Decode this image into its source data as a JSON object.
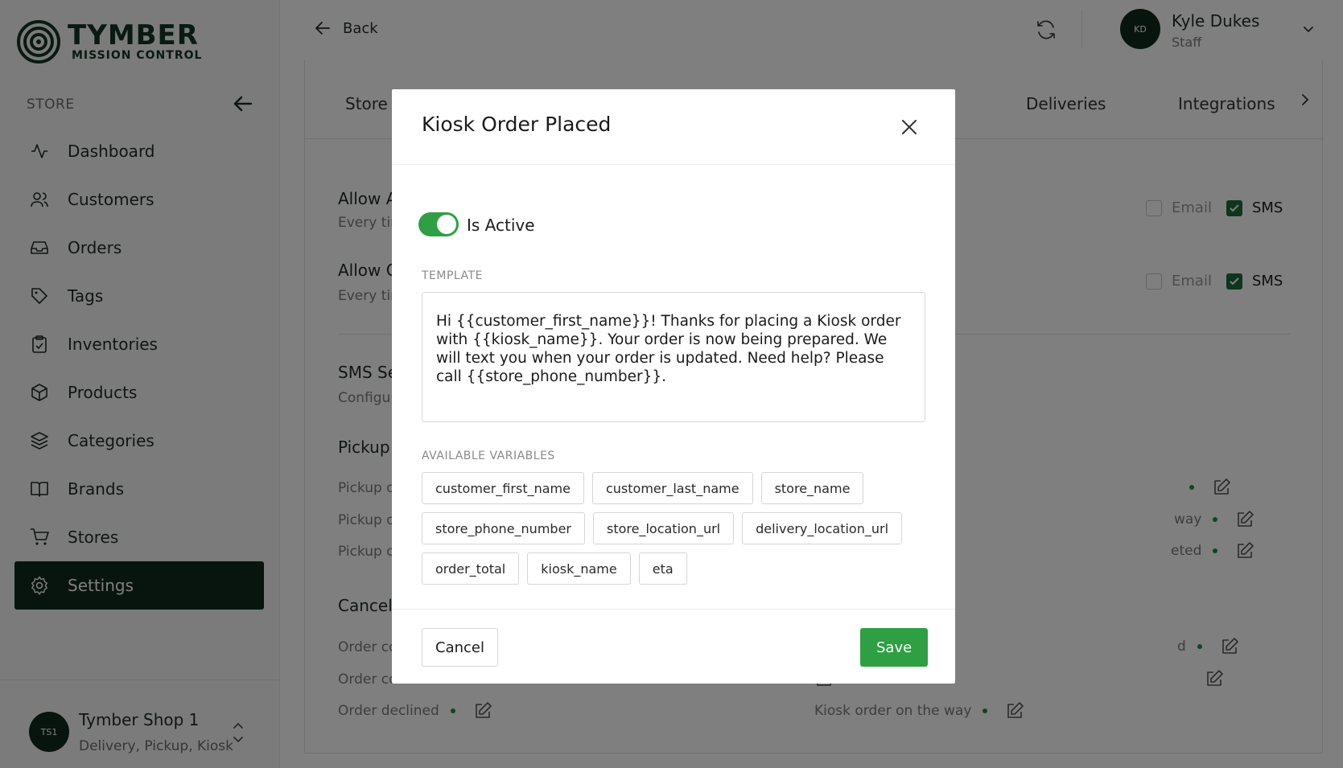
{
  "brand": {
    "title": "TYMBER",
    "subtitle": "MISSION CONTROL"
  },
  "sidebar": {
    "section_label": "STORE",
    "items": [
      {
        "label": "Dashboard",
        "icon": "activity-icon"
      },
      {
        "label": "Customers",
        "icon": "users-icon"
      },
      {
        "label": "Orders",
        "icon": "inbox-icon"
      },
      {
        "label": "Tags",
        "icon": "tag-icon"
      },
      {
        "label": "Inventories",
        "icon": "clipboard-icon"
      },
      {
        "label": "Products",
        "icon": "box-icon"
      },
      {
        "label": "Categories",
        "icon": "layers-icon"
      },
      {
        "label": "Brands",
        "icon": "book-icon"
      },
      {
        "label": "Stores",
        "icon": "cart-icon"
      },
      {
        "label": "Settings",
        "icon": "gear-icon",
        "active": true
      }
    ],
    "store": {
      "initials": "TS1",
      "name": "Tymber Shop 1",
      "types": "Delivery, Pickup, Kiosk"
    }
  },
  "topbar": {
    "back_label": "Back",
    "user": {
      "initials": "KD",
      "name": "Kyle Dukes",
      "role": "Staff"
    }
  },
  "tabs": {
    "first_partial": "Store C",
    "deliveries": "Deliveries",
    "integrations": "Integrations"
  },
  "background": {
    "row1": {
      "title": "Allow A",
      "desc": "Every tin"
    },
    "row2": {
      "title": "Allow C",
      "desc": "Every tin"
    },
    "email_label": "Email",
    "sms_label": "SMS",
    "sms_section": {
      "title": "SMS Se",
      "desc": "Configur"
    },
    "pickup_title": "Pickup",
    "pickup_rows": [
      "Pickup o",
      "Pickup o",
      "Pickup o"
    ],
    "pickup_right": [
      "",
      "way",
      "eted"
    ],
    "cancel_title": "Cancell",
    "cancel_rows": [
      "Order co",
      "Order co",
      "Order declined"
    ],
    "cancel_right": [
      "d",
      "",
      "Kiosk order on the way"
    ]
  },
  "modal": {
    "title": "Kiosk Order Placed",
    "toggle_label": "Is Active",
    "is_active": true,
    "template_label": "TEMPLATE",
    "template_text": "Hi {{customer_first_name}}! Thanks for placing a Kiosk order with {{kiosk_name}}. Your order is now being prepared. We will text you when your order is updated. Need help? Please call {{store_phone_number}}.",
    "variables_label": "AVAILABLE VARIABLES",
    "variables": [
      [
        "customer_first_name",
        "customer_last_name",
        "store_name"
      ],
      [
        "store_phone_number",
        "store_location_url",
        "delivery_location_url"
      ],
      [
        "order_total",
        "kiosk_name",
        "eta"
      ]
    ],
    "cancel_label": "Cancel",
    "save_label": "Save"
  },
  "colors": {
    "brand_dark": "#0f2a1c",
    "accent_green": "#2ea043",
    "checkbox_green": "#1d6b3a"
  }
}
